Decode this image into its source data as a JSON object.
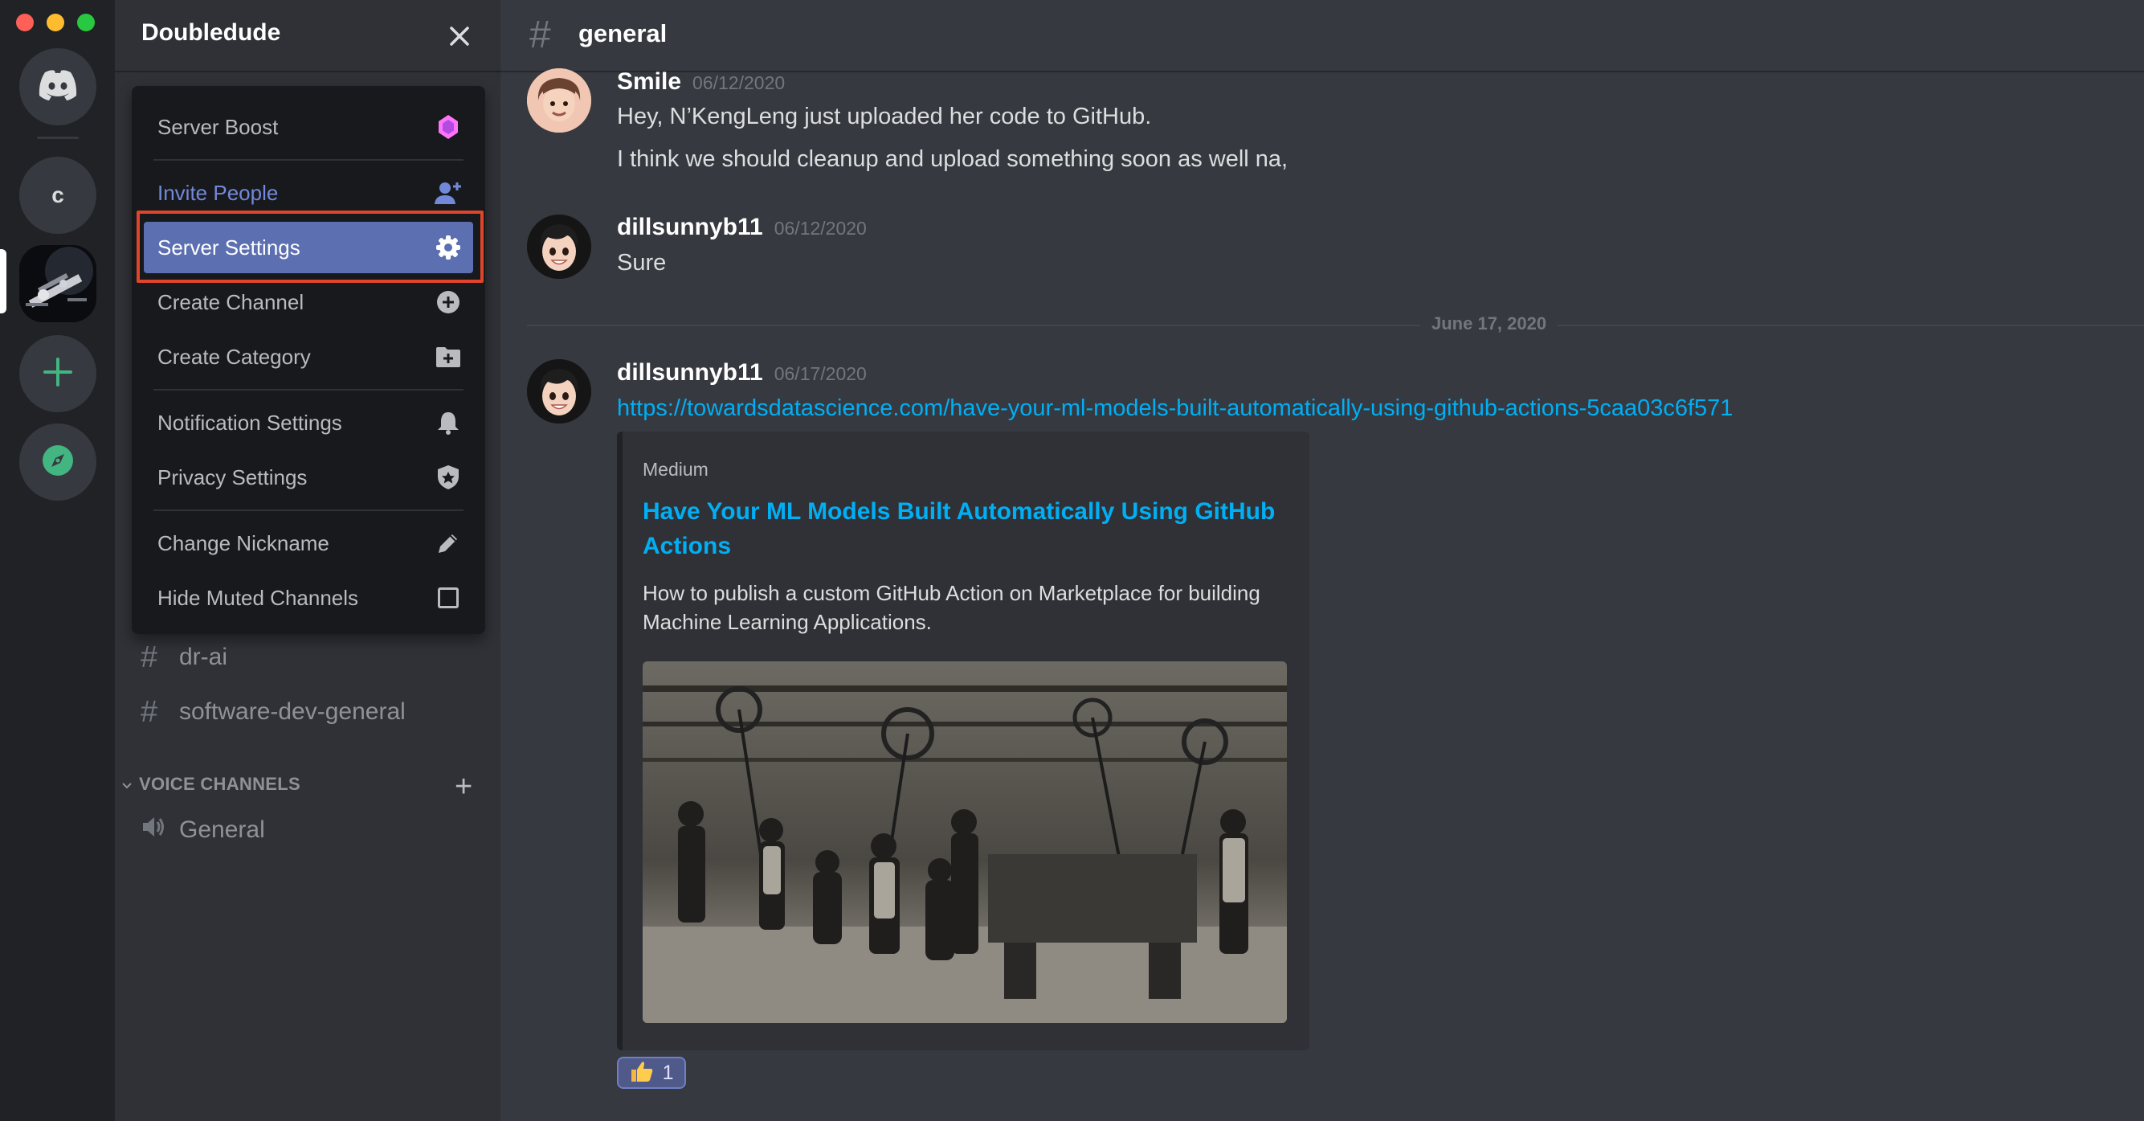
{
  "window": {
    "traffic_lights": [
      "close",
      "minimize",
      "maximize"
    ]
  },
  "rail": {
    "servers": [
      {
        "name": "home",
        "icon": "discord-logo-icon"
      },
      {
        "name": "server-c",
        "label": "c"
      },
      {
        "name": "server-active",
        "icon": "server-image"
      },
      {
        "name": "add-server",
        "icon": "plus-icon"
      },
      {
        "name": "explore",
        "icon": "compass-icon"
      }
    ]
  },
  "sidebar": {
    "server_name": "Doubledude",
    "channels": [
      {
        "type": "text",
        "name": "dr-ai"
      },
      {
        "type": "text",
        "name": "software-dev-general"
      }
    ],
    "voice_header": "VOICE CHANNELS",
    "voice_channels": [
      {
        "type": "voice",
        "name": "General"
      }
    ]
  },
  "menu": {
    "items": [
      {
        "label": "Server Boost",
        "icon": "boost-gem-icon"
      },
      {
        "label": "Invite People",
        "icon": "add-person-icon"
      },
      {
        "label": "Server Settings",
        "icon": "gear-icon",
        "selected": true
      },
      {
        "label": "Create Channel",
        "icon": "plus-circle-icon"
      },
      {
        "label": "Create Category",
        "icon": "folder-plus-icon"
      },
      {
        "label": "Notification Settings",
        "icon": "bell-icon"
      },
      {
        "label": "Privacy Settings",
        "icon": "shield-icon"
      },
      {
        "label": "Change Nickname",
        "icon": "pencil-icon"
      },
      {
        "label": "Hide Muted Channels",
        "icon": "checkbox-icon",
        "checked": false
      }
    ]
  },
  "chat": {
    "channel": "general",
    "messages": [
      {
        "user": "Smile",
        "time": "06/12/2020",
        "lines": [
          "Hey, N’KengLeng just uploaded her code to GitHub.",
          "I think we should cleanup and upload something soon as well na,"
        ]
      },
      {
        "user": "dillsunnyb11",
        "time": "06/12/2020",
        "lines": [
          "Sure"
        ]
      },
      {
        "user": "dillsunnyb11",
        "time": "06/17/2020",
        "link": "https://towardsdatascience.com/have-your-ml-models-built-automatically-using-github-actions-5caa03c6f571",
        "embed": {
          "provider": "Medium",
          "title": "Have Your ML Models Built Automatically Using GitHub Actions",
          "description": "How to publish a custom GitHub Action on Marketplace for building Machine Learning Applications."
        },
        "reaction": {
          "emoji": "thumbs-up-icon",
          "count": "1"
        }
      }
    ],
    "date_divider": "June 17, 2020"
  },
  "colors": {
    "accent": "#5c6fb1",
    "link": "#00aff4",
    "highlight_box": "#e0452b",
    "invite": "#7289da",
    "boost": "#ff73fa"
  }
}
